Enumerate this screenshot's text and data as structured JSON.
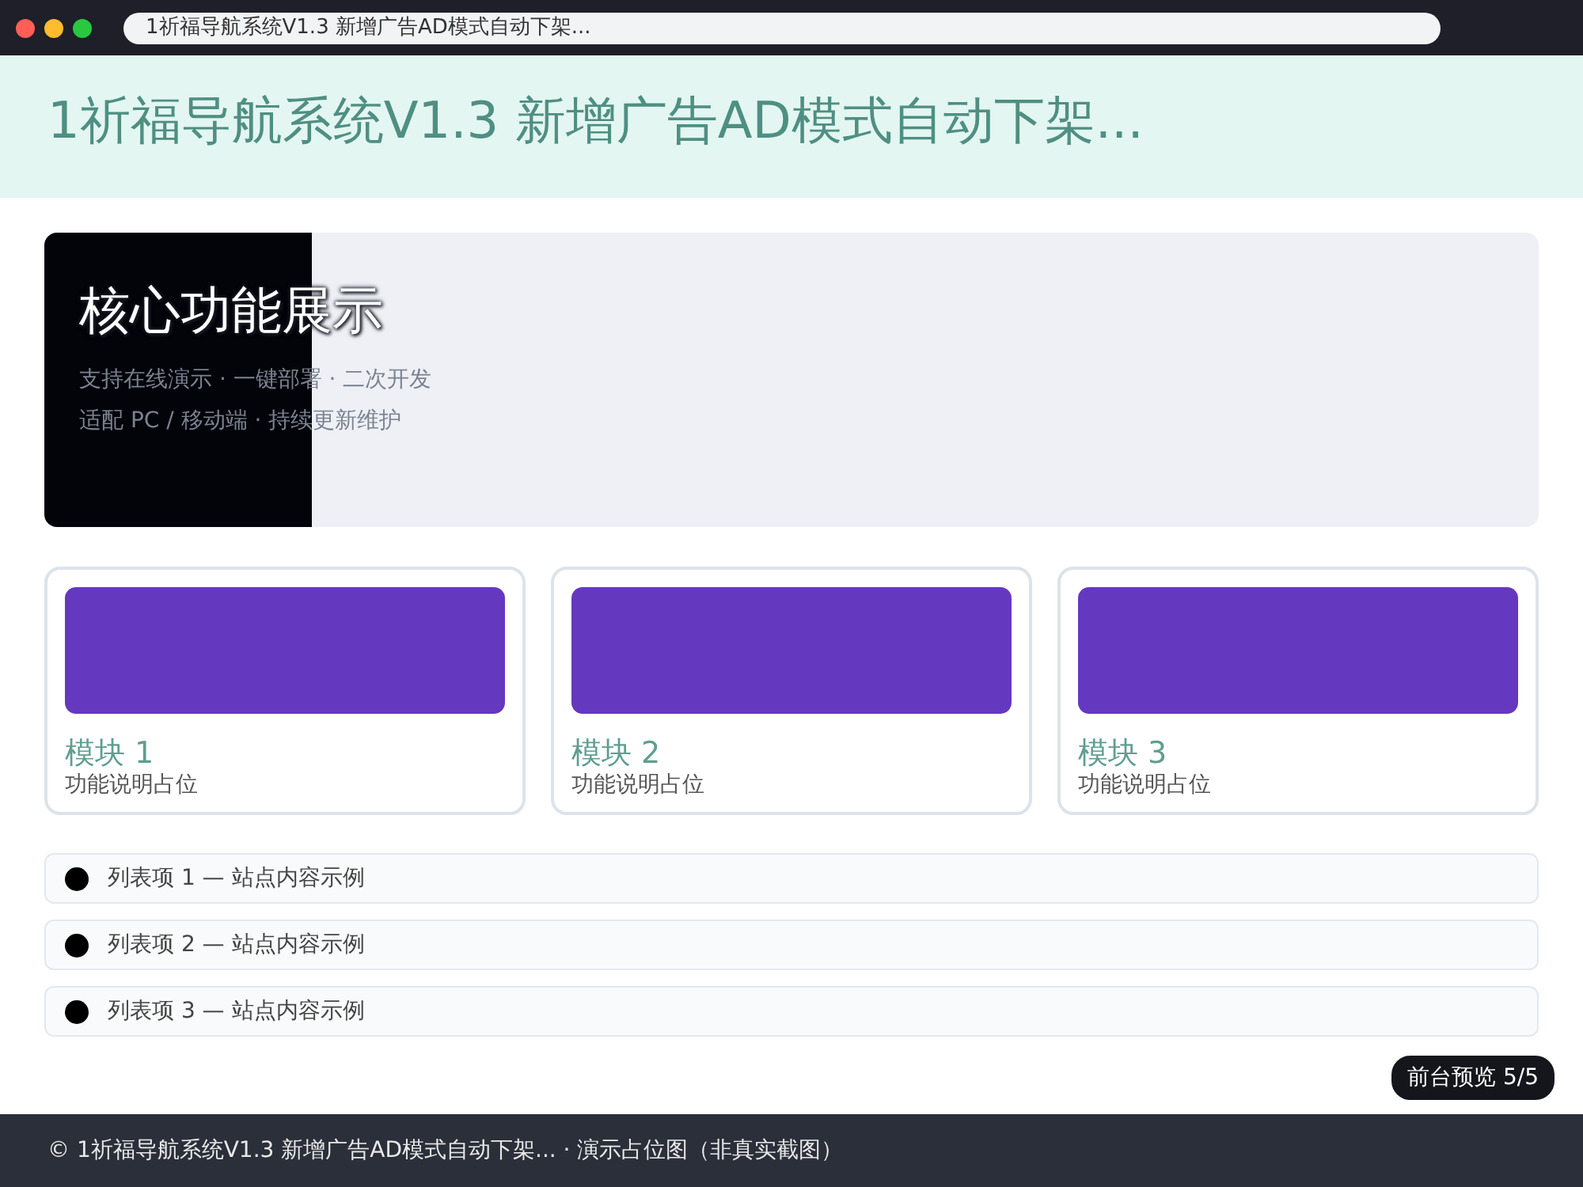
{
  "browser": {
    "address": "1祈福导航系统V1.3 新增广告AD模式自动下架..."
  },
  "header": {
    "title": "1祈福导航系统V1.3 新增广告AD模式自动下架..."
  },
  "hero": {
    "title": "核心功能展示",
    "lines": [
      "支持在线演示 · 一键部署 · 二次开发",
      "适配 PC / 移动端 · 持续更新维护"
    ]
  },
  "cards": [
    {
      "title": "模块 1",
      "text": "功能说明占位",
      "color": "#6538c0"
    },
    {
      "title": "模块 2",
      "text": "功能说明占位",
      "color": "#6538c0"
    },
    {
      "title": "模块 3",
      "text": "功能说明占位",
      "color": "#6538c0"
    }
  ],
  "list": [
    "列表项 1 — 站点内容示例",
    "列表项 2 — 站点内容示例",
    "列表项 3 — 站点内容示例"
  ],
  "badge": "前台预览 5/5",
  "footer": "© 1祈福导航系统V1.3 新增广告AD模式自动下架... · 演示占位图（非真实截图）"
}
